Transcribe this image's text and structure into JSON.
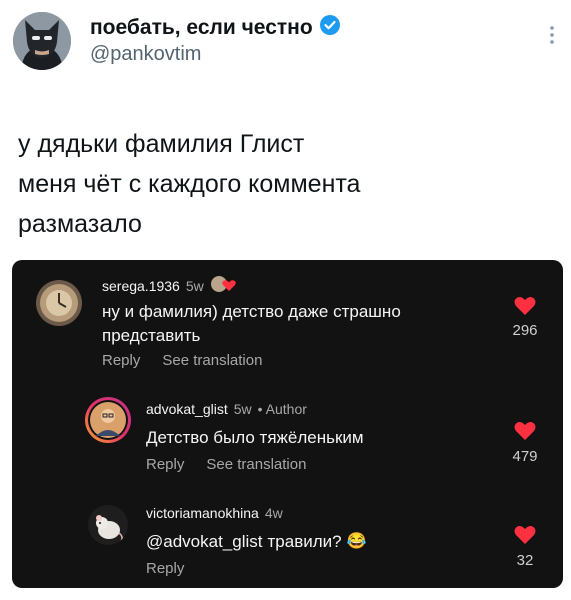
{
  "tweet": {
    "author_name": "поебать, если честно",
    "handle": "@pankovtim",
    "verified_icon": "verified-badge-icon",
    "more_icon": "more-vertical-icon",
    "text_lines": [
      "у дядьки фамилия Глист",
      "меня чёт с каждого коммента",
      "размазало"
    ]
  },
  "comments": [
    {
      "username": "serega.1936",
      "age": "5w",
      "text_lines": [
        "ну и фамилия) детство даже страшно",
        "представить"
      ],
      "reply_label": "Reply",
      "translate_label": "See translation",
      "likes": "296",
      "liked_by_author": true
    },
    {
      "username": "advokat_glist",
      "age": "5w",
      "badge": "• Author",
      "text_lines": [
        "Детство было тяжёленьким"
      ],
      "reply_label": "Reply",
      "translate_label": "See translation",
      "likes": "479"
    },
    {
      "username": "victoriamanokhina",
      "age": "4w",
      "mention": "@advokat_glist",
      "text_rest": "травили?",
      "emoji": "😂",
      "reply_label": "Reply",
      "likes": "32"
    }
  ],
  "colors": {
    "heart": "#ff3040",
    "panel": "#121212",
    "verified": "#1d9bf0"
  }
}
